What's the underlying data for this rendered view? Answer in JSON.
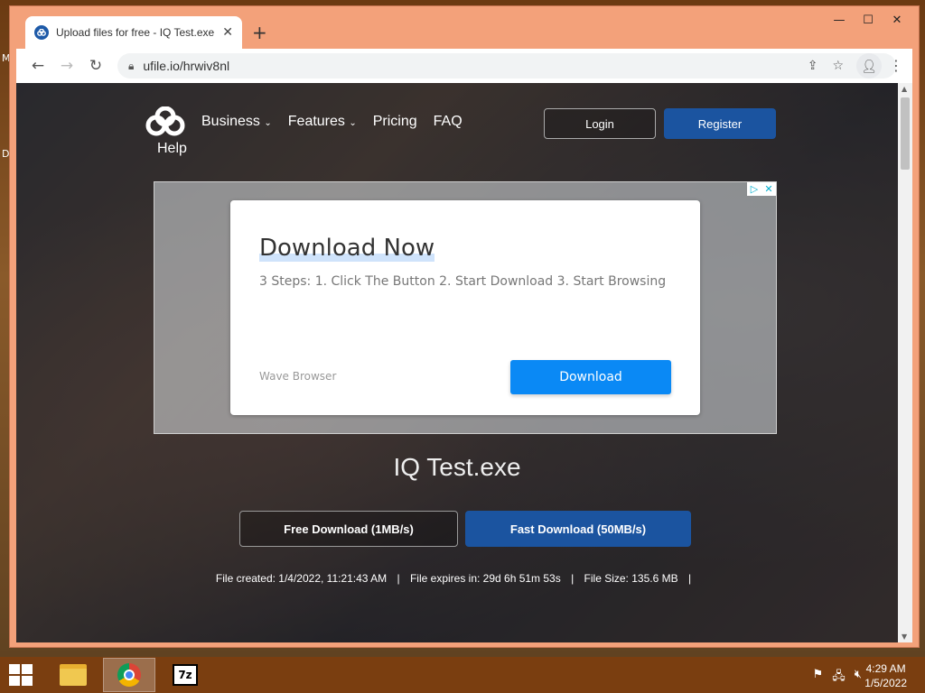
{
  "desktop": {
    "edge_letters": [
      "M",
      "D"
    ]
  },
  "browser": {
    "tab": {
      "title": "Upload files for free - IQ Test.exe",
      "close_label": "✕",
      "favicon": "ufile-logo-icon"
    },
    "new_tab_label": "+",
    "window_controls": {
      "minimize": "—",
      "maximize": "☐",
      "close": "✕"
    },
    "url": "ufile.io/hrwiv8nl"
  },
  "site": {
    "help_label": "Help",
    "nav": [
      {
        "label": "Business",
        "has_dropdown": true
      },
      {
        "label": "Features",
        "has_dropdown": true
      },
      {
        "label": "Pricing",
        "has_dropdown": false
      },
      {
        "label": "FAQ",
        "has_dropdown": false
      }
    ],
    "login_label": "Login",
    "register_label": "Register",
    "ad": {
      "title": "Download Now",
      "subtitle": "3 Steps: 1. Click The Button 2. Start Download 3. Start Browsing",
      "brand": "Wave Browser",
      "button_label": "Download"
    },
    "file_name": "IQ Test.exe",
    "free_download_label": "Free Download (1MB/s)",
    "fast_download_label": "Fast Download (50MB/s)",
    "file_info": {
      "created": "File created: 1/4/2022, 11:21:43 AM",
      "expires": "File expires in: 29d 6h 51m 53s",
      "size": "File Size: 135.6 MB"
    }
  },
  "taskbar": {
    "clock_time": "4:29 AM",
    "clock_date": "1/5/2022"
  },
  "colors": {
    "brand_blue": "#1b54a0",
    "ad_button": "#0a89f5"
  }
}
